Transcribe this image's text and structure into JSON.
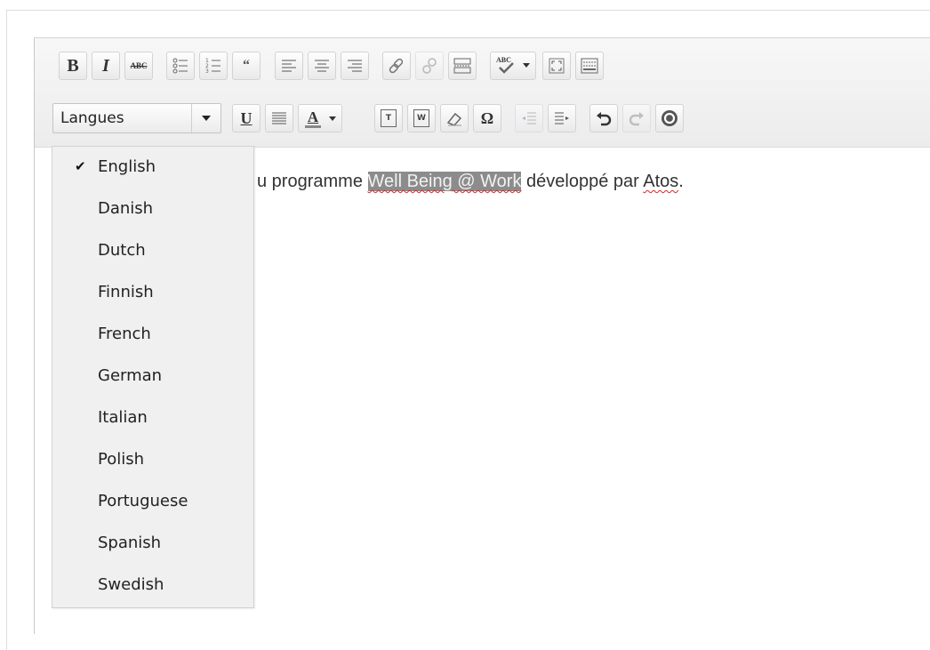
{
  "toolbar": {
    "row1": [
      {
        "name": "bold-button",
        "icon": "bold-icon",
        "label": "B"
      },
      {
        "name": "italic-button",
        "icon": "italic-icon",
        "label": "I"
      },
      {
        "name": "strikethrough-button",
        "icon": "strikethrough-icon",
        "label": "ABC"
      },
      {
        "name": "bullet-list-button",
        "icon": "bullet-list-icon"
      },
      {
        "name": "numbered-list-button",
        "icon": "numbered-list-icon"
      },
      {
        "name": "blockquote-button",
        "icon": "quote-icon",
        "label": "66"
      },
      {
        "name": "align-left-button",
        "icon": "align-left-icon"
      },
      {
        "name": "align-center-button",
        "icon": "align-center-icon"
      },
      {
        "name": "align-right-button",
        "icon": "align-right-icon"
      },
      {
        "name": "insert-link-button",
        "icon": "link-icon"
      },
      {
        "name": "remove-link-button",
        "icon": "unlink-icon"
      },
      {
        "name": "insert-more-button",
        "icon": "more-tag-icon"
      },
      {
        "name": "spellcheck-button",
        "icon": "spellcheck-icon",
        "label": "ABC"
      },
      {
        "name": "fullscreen-button",
        "icon": "fullscreen-icon"
      },
      {
        "name": "kitchen-sink-button",
        "icon": "kitchen-sink-icon"
      }
    ],
    "row2": [
      {
        "name": "underline-button",
        "icon": "underline-icon",
        "label": "U"
      },
      {
        "name": "justify-button",
        "icon": "justify-icon"
      },
      {
        "name": "text-color-button",
        "icon": "text-color-icon",
        "label": "A"
      },
      {
        "name": "paste-text-button",
        "icon": "paste-text-icon",
        "label": "T"
      },
      {
        "name": "paste-word-button",
        "icon": "paste-word-icon",
        "label": "W"
      },
      {
        "name": "remove-format-button",
        "icon": "eraser-icon"
      },
      {
        "name": "special-char-button",
        "icon": "omega-icon",
        "label": "Ω"
      },
      {
        "name": "outdent-button",
        "icon": "outdent-icon"
      },
      {
        "name": "indent-button",
        "icon": "indent-icon"
      },
      {
        "name": "undo-button",
        "icon": "undo-icon"
      },
      {
        "name": "redo-button",
        "icon": "redo-icon"
      },
      {
        "name": "help-button",
        "icon": "help-icon"
      }
    ],
    "language_select": {
      "label": "Langues"
    }
  },
  "content": {
    "prefix": "u programme ",
    "highlight": "Well Being @ Work",
    "middle": " développé par ",
    "last_word": "Atos",
    "end": "."
  },
  "dropdown": {
    "selected": "English",
    "items": [
      "English",
      "Danish",
      "Dutch",
      "Finnish",
      "French",
      "German",
      "Italian",
      "Polish",
      "Portuguese",
      "Spanish",
      "Swedish"
    ]
  }
}
